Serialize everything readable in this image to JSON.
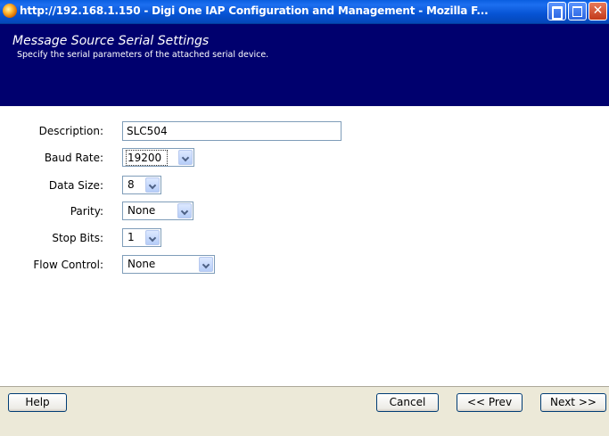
{
  "window": {
    "title": "http://192.168.1.150 - Digi One IAP Configuration and Management - Mozilla F..."
  },
  "header": {
    "title": "Message Source Serial Settings",
    "subtitle": "Specify the serial parameters of the attached serial device."
  },
  "form": {
    "description": {
      "label": "Description:",
      "value": "SLC504"
    },
    "baud_rate": {
      "label": "Baud Rate:",
      "value": "19200"
    },
    "data_size": {
      "label": "Data Size:",
      "value": "8"
    },
    "parity": {
      "label": "Parity:",
      "value": "None"
    },
    "stop_bits": {
      "label": "Stop Bits:",
      "value": "1"
    },
    "flow_control": {
      "label": "Flow Control:",
      "value": "None"
    }
  },
  "buttons": {
    "help": "Help",
    "cancel": "Cancel",
    "prev": "<< Prev",
    "next": "Next >>"
  },
  "icons": {
    "app": "firefox-icon",
    "minimize": "minimize-icon",
    "maximize": "maximize-icon",
    "close": "close-icon",
    "dropdown": "chevron-down-icon"
  },
  "colors": {
    "titlebar": "#0653d4",
    "header_bg": "#00006e",
    "content_bg": "#ffffff",
    "footer_bg": "#ece9d8"
  }
}
